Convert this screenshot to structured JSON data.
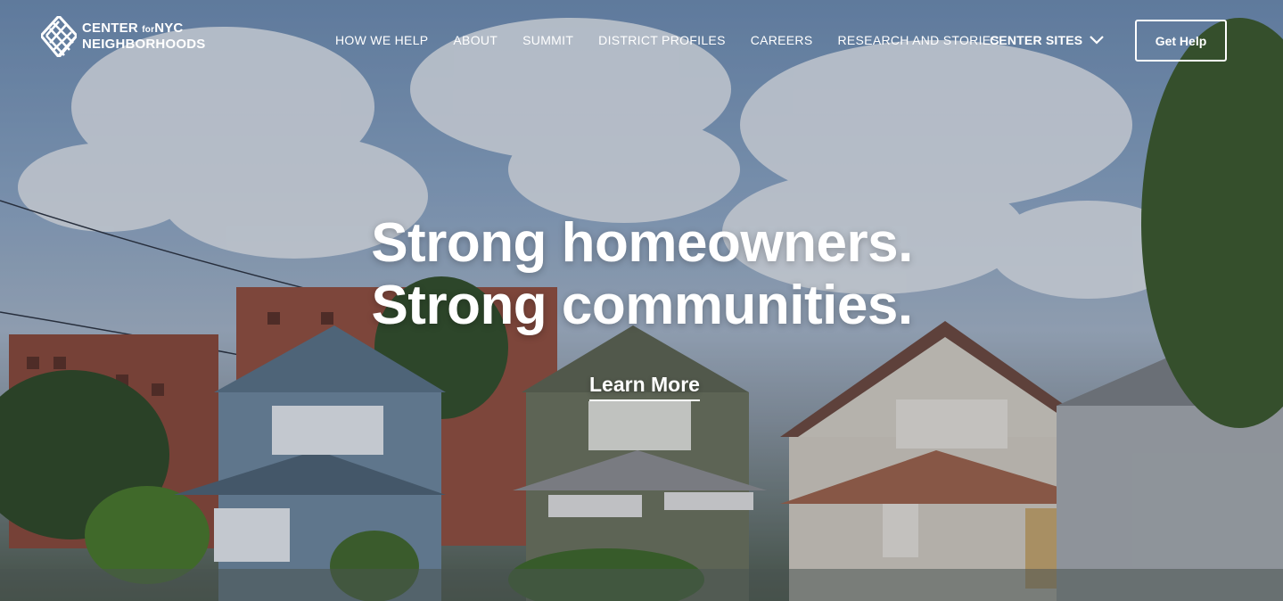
{
  "brand": {
    "line1": "CENTER",
    "line1_small": "for",
    "line1_end": "NYC",
    "line2": "NEIGHBORHOODS"
  },
  "nav": {
    "items": [
      {
        "label": "HOW WE HELP"
      },
      {
        "label": "ABOUT"
      },
      {
        "label": "SUMMIT"
      },
      {
        "label": "DISTRICT PROFILES"
      },
      {
        "label": "CAREERS"
      },
      {
        "label": "RESEARCH AND STORIES"
      }
    ],
    "center_sites": "CENTER SITES",
    "get_help": "Get Help"
  },
  "hero": {
    "headline": "Strong homeowners. Strong communities.",
    "cta": "Learn More"
  }
}
